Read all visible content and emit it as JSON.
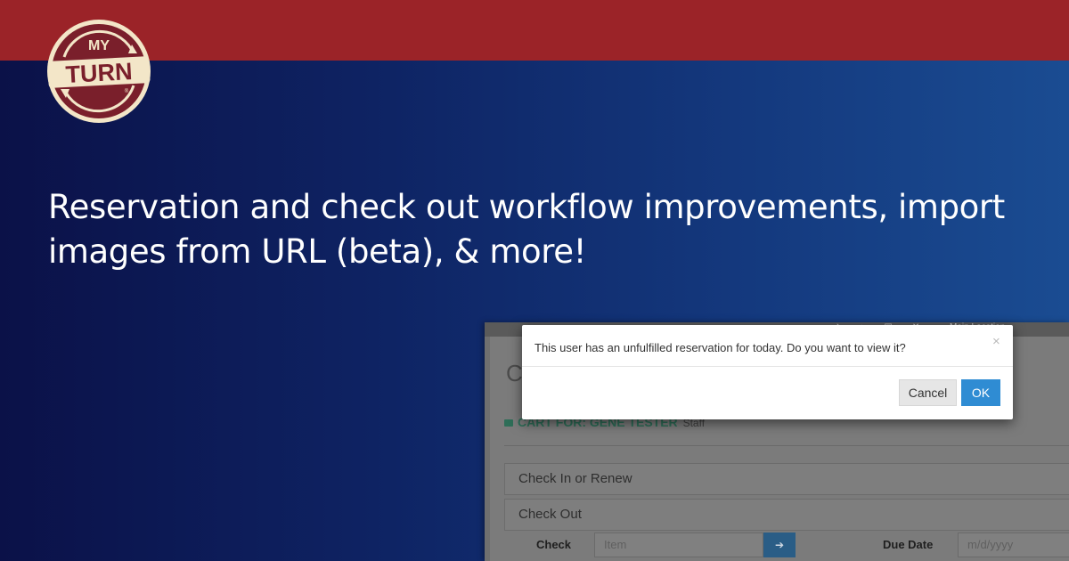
{
  "brand": {
    "logo_top": "MY",
    "logo_main": "TURN",
    "logo_mark": "®",
    "colors": {
      "banner_red": "#9b2328",
      "navy": "#0b1148",
      "logo_maroon": "#7a1f2b",
      "logo_cream": "#f3e6c8"
    }
  },
  "headline": {
    "line1": "Reservation and check out workflow improvements, import",
    "line2": "images from URL (beta), & more!"
  },
  "screenshot": {
    "toolbar_text": "Main Location",
    "page_title": "Ch",
    "cart_label": "CART FOR: GENE TESTER",
    "cart_role": "Staff",
    "panels": [
      "Check In or Renew",
      "Check Out"
    ],
    "form": {
      "check_label": "Check",
      "item_placeholder": "Item",
      "due_label": "Due Date",
      "due_placeholder": "m/d/yyyy"
    }
  },
  "modal": {
    "message": "This user has an unfulfilled reservation for today. Do you want to view it?",
    "close_symbol": "×",
    "cancel_label": "Cancel",
    "ok_label": "OK",
    "ok_color": "#2f8cd3"
  }
}
